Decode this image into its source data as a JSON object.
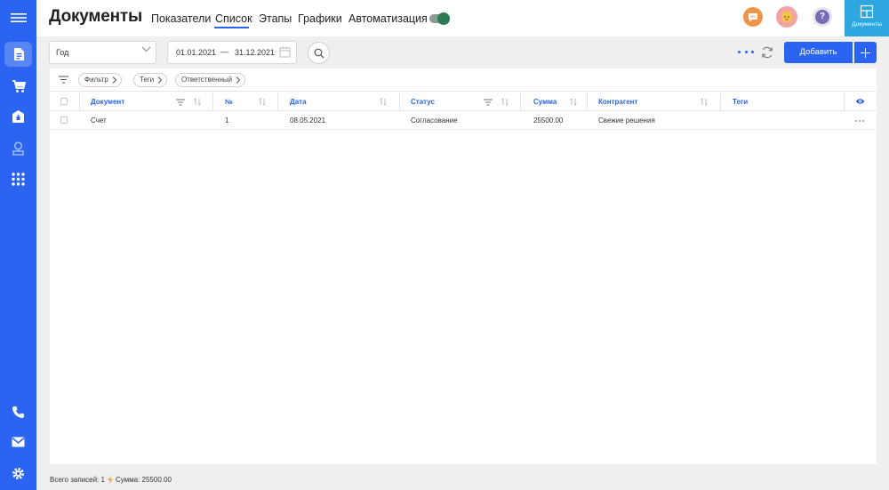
{
  "header": {
    "title": "Документы",
    "tabs": [
      {
        "label": "Показатели"
      },
      {
        "label": "Список"
      },
      {
        "label": "Этапы"
      },
      {
        "label": "Графики"
      },
      {
        "label": "Автоматизация"
      }
    ],
    "active_tab": "Список",
    "docs_tile_label": "Документы"
  },
  "toolbar": {
    "period": "Год",
    "date_from": "01.01.2021",
    "date_separator": "—",
    "date_to": "31.12.2021",
    "add_label": "Добавить"
  },
  "filters": {
    "chips": [
      "Фильтр",
      "Теги",
      "Ответственный"
    ]
  },
  "table": {
    "columns": [
      "Документ",
      "№",
      "Дата",
      "Статус",
      "Сумма",
      "Контрагент",
      "Теги"
    ],
    "rows": [
      {
        "document": "Счет",
        "number": "1",
        "date": "08.05.2021",
        "status": "Согласование",
        "amount": "25500.00",
        "counterparty": "Свежие решения",
        "tags": ""
      }
    ]
  },
  "footer": {
    "records_label": "Всего записей: 1",
    "sum_label": "Сумма: 25500.00"
  },
  "colors": {
    "accent": "#2a64f0",
    "sidebar": "#2a64f0",
    "docs_tile": "#2ea7e0",
    "chat_icon": "#f0944a",
    "avatar": "#f4a3a3",
    "help_icon": "#7b68b8"
  },
  "icons": {
    "sidebar_top": "menu-icon",
    "sidebar": [
      "document-icon",
      "cart-icon",
      "briefcase-icon",
      "location-icon",
      "apps-grid-icon"
    ],
    "sidebar_bottom": [
      "phone-icon",
      "mail-icon",
      "settings-icon"
    ]
  }
}
